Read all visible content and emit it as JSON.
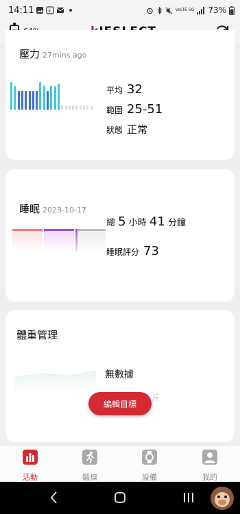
{
  "status_bar": {
    "time": "14:11",
    "signal_label": "VoLTE 5G",
    "battery_percent": "73%"
  },
  "header": {
    "watch_battery": "64%",
    "watch_battery_level": 0.64,
    "logo_text": "IESLECT"
  },
  "stress": {
    "title": "壓力",
    "updated": "27mins ago",
    "avg_label": "平均",
    "avg_value": "32",
    "range_label": "範圍",
    "range_value": "25-51",
    "state_label": "狀態",
    "state_value": "正常"
  },
  "sleep": {
    "title": "睡眠",
    "date": "2023-10-17",
    "total_prefix": "總",
    "hours": "5",
    "hours_unit": "小時",
    "minutes": "41",
    "minutes_unit": "分鐘",
    "score_label": "睡眠評分",
    "score_value": "73"
  },
  "weight": {
    "title": "體重管理",
    "no_data": "無數據",
    "unit_ghost": "斤",
    "edit_button": "編輯目標"
  },
  "bottom_nav": {
    "items": [
      {
        "label": "活動"
      },
      {
        "label": "鍛煉"
      },
      {
        "label": "設備"
      },
      {
        "label": "我的"
      }
    ]
  },
  "colors": {
    "accent": "#d42a33",
    "stress_blue": "#3d6fe0",
    "stress_cyan": "#45c8d8",
    "stress_inactive": "#d8dde3",
    "sleep_red": "#f27a7a",
    "sleep_purple": "#a14de0",
    "sleep_gray": "#b8b8b8"
  }
}
